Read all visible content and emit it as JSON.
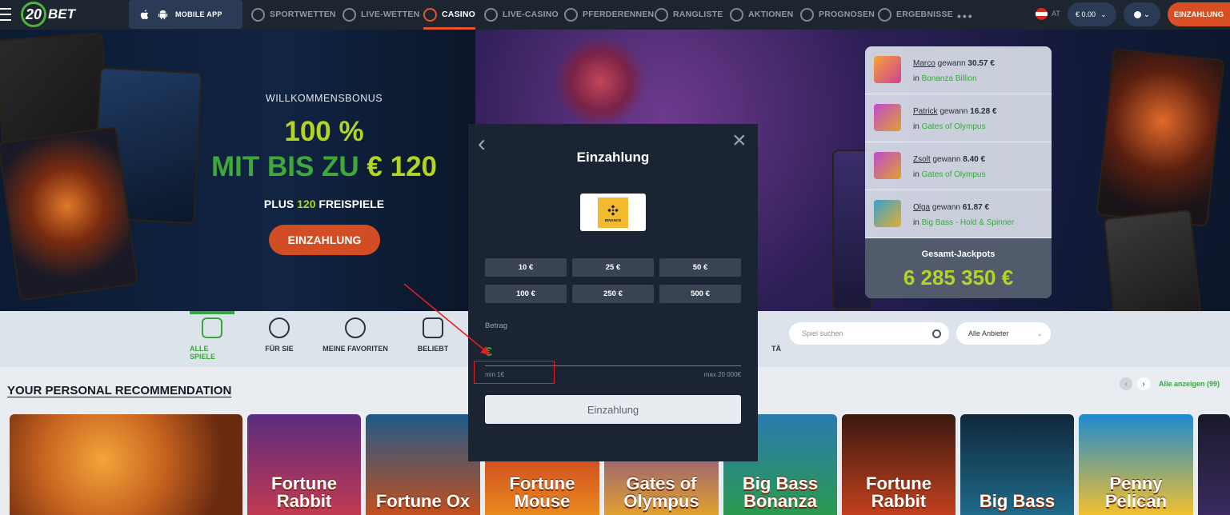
{
  "nav": {
    "mobile_app": "MOBILE APP",
    "items": [
      {
        "label": "SPORTWETTEN",
        "icon": "soccer-ball-icon"
      },
      {
        "label": "LIVE-WETTEN",
        "icon": "stopwatch-icon"
      },
      {
        "label": "CASINO",
        "icon": "roulette-icon",
        "active": true
      },
      {
        "label": "LIVE-CASINO",
        "icon": "cards-icon"
      },
      {
        "label": "PFERDERENNEN",
        "icon": "horse-icon"
      },
      {
        "label": "RANGLISTE",
        "icon": "laurel-icon"
      },
      {
        "label": "AKTIONEN",
        "icon": "megaphone-icon"
      },
      {
        "label": "PROGNOSEN",
        "icon": "cursor-icon"
      },
      {
        "label": "ERGEBNISSE",
        "icon": "tools-icon"
      }
    ],
    "more": "•••",
    "lang": "AT",
    "balance": "€ 0.00",
    "cta": "EINZAHLUNG"
  },
  "hero": {
    "kicker": "WILLKOMMENSBONUS",
    "percent": "100 %",
    "line_green": "MIT BIS ZU",
    "line_amount": "€ 120",
    "plus": "PLUS",
    "spins_num": "120",
    "spins": "FREISPIELE",
    "cta": "EINZAHLUNG"
  },
  "winners": {
    "gewann": "gewann",
    "in": "in",
    "rows": [
      {
        "name": "Marco",
        "amount": "30.57 €",
        "game": "Bonanza Billion"
      },
      {
        "name": "Patrick",
        "amount": "16.28 €",
        "game": "Gates of Olympus"
      },
      {
        "name": "Zsolt",
        "amount": "8.40 €",
        "game": "Gates of Olympus"
      },
      {
        "name": "Olga",
        "amount": "61.87 €",
        "game": "Big Bass - Hold & Spinner"
      }
    ],
    "jackpot_label": "Gesamt-Jackpots",
    "jackpot_value": "6 285 350 €"
  },
  "categories": [
    {
      "label": "ALLE SPIELE",
      "icon": "dice-icon",
      "active": true
    },
    {
      "label": "FÜR SIE",
      "icon": "person-stars-icon"
    },
    {
      "label": "MEINE FAVORITEN",
      "icon": "heart-icon"
    },
    {
      "label": "BELIEBT",
      "icon": "crown-icon"
    },
    {
      "label": "TÄ",
      "icon": ""
    }
  ],
  "search": {
    "placeholder": "Spiel suchen"
  },
  "providers": {
    "label": "Alle Anbieter"
  },
  "recommendation": {
    "title": "YOUR PERSONAL RECOMMENDATION",
    "see_all": "Alle anzeigen (99)",
    "tiles": [
      "",
      "Fortune Rabbit",
      "Fortune Ox",
      "Fortune Mouse",
      "Gates of Olympus",
      "Big Bass Bonanza",
      "Fortune Rabbit",
      "Big Bass",
      "Penny Pelican",
      ""
    ]
  },
  "modal": {
    "title": "Einzahlung",
    "provider_logo_text": "BINANCE",
    "amounts": [
      "10 €",
      "25 €",
      "50 €",
      "100 €",
      "250 €",
      "500 €"
    ],
    "field_label": "Betrag",
    "currency_symbol": "€",
    "min": "min 1€",
    "max": "max 20 000€",
    "submit": "Einzahlung"
  },
  "colors": {
    "accent_orange": "#d94f24",
    "accent_green": "#3fa83a",
    "accent_lime": "#b4d424",
    "nav_bg": "#1d2530",
    "modal_bg": "#1b2433",
    "annotation_red": "#e12020"
  }
}
